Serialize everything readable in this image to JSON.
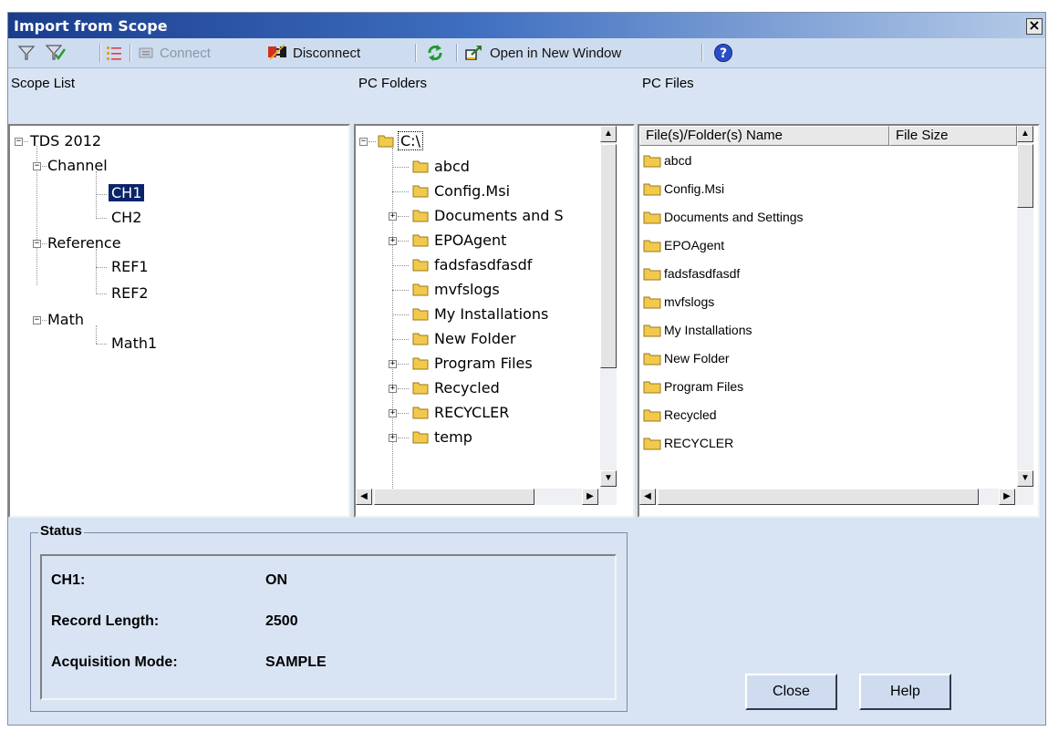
{
  "window": {
    "title": "Import from Scope"
  },
  "toolbar": {
    "connect_label": "Connect",
    "disconnect_label": "Disconnect",
    "open_new_window_label": "Open in New Window"
  },
  "scope_list": {
    "header": "Scope List",
    "root": "TDS 2012",
    "groups": [
      {
        "label": "Channel",
        "children": [
          "CH1",
          "CH2"
        ]
      },
      {
        "label": "Reference",
        "children": [
          "REF1",
          "REF2"
        ]
      },
      {
        "label": "Math",
        "children": [
          "Math1"
        ]
      }
    ],
    "selected": "CH1"
  },
  "pc_folders": {
    "header": "PC Folders",
    "root": "C:\\",
    "items": [
      "abcd",
      "Config.Msi",
      "Documents and S",
      "EPOAgent",
      "fadsfasdfasdf",
      "mvfslogs",
      "My Installations",
      "New Folder",
      "Program Files",
      "Recycled",
      "RECYCLER",
      "temp"
    ]
  },
  "pc_files": {
    "header": "PC Files",
    "columns": [
      "File(s)/Folder(s) Name",
      "File Size"
    ],
    "rows": [
      "abcd",
      "Config.Msi",
      "Documents and Settings",
      "EPOAgent",
      "fadsfasdfasdf",
      "mvfslogs",
      "My Installations",
      "New Folder",
      "Program Files",
      "Recycled",
      "RECYCLER"
    ]
  },
  "status": {
    "legend": "Status",
    "rows": [
      {
        "label": "CH1:",
        "value": "ON"
      },
      {
        "label": "Record Length:",
        "value": "2500"
      },
      {
        "label": "Acquisition Mode:",
        "value": "SAMPLE"
      }
    ]
  },
  "buttons": {
    "close": "Close",
    "help": "Help"
  },
  "colors": {
    "title_bar_start": "#1a3c8c",
    "dialog_bg": "#d8e4f4",
    "selection": "#0a246a",
    "folder": "#f2c94c"
  }
}
